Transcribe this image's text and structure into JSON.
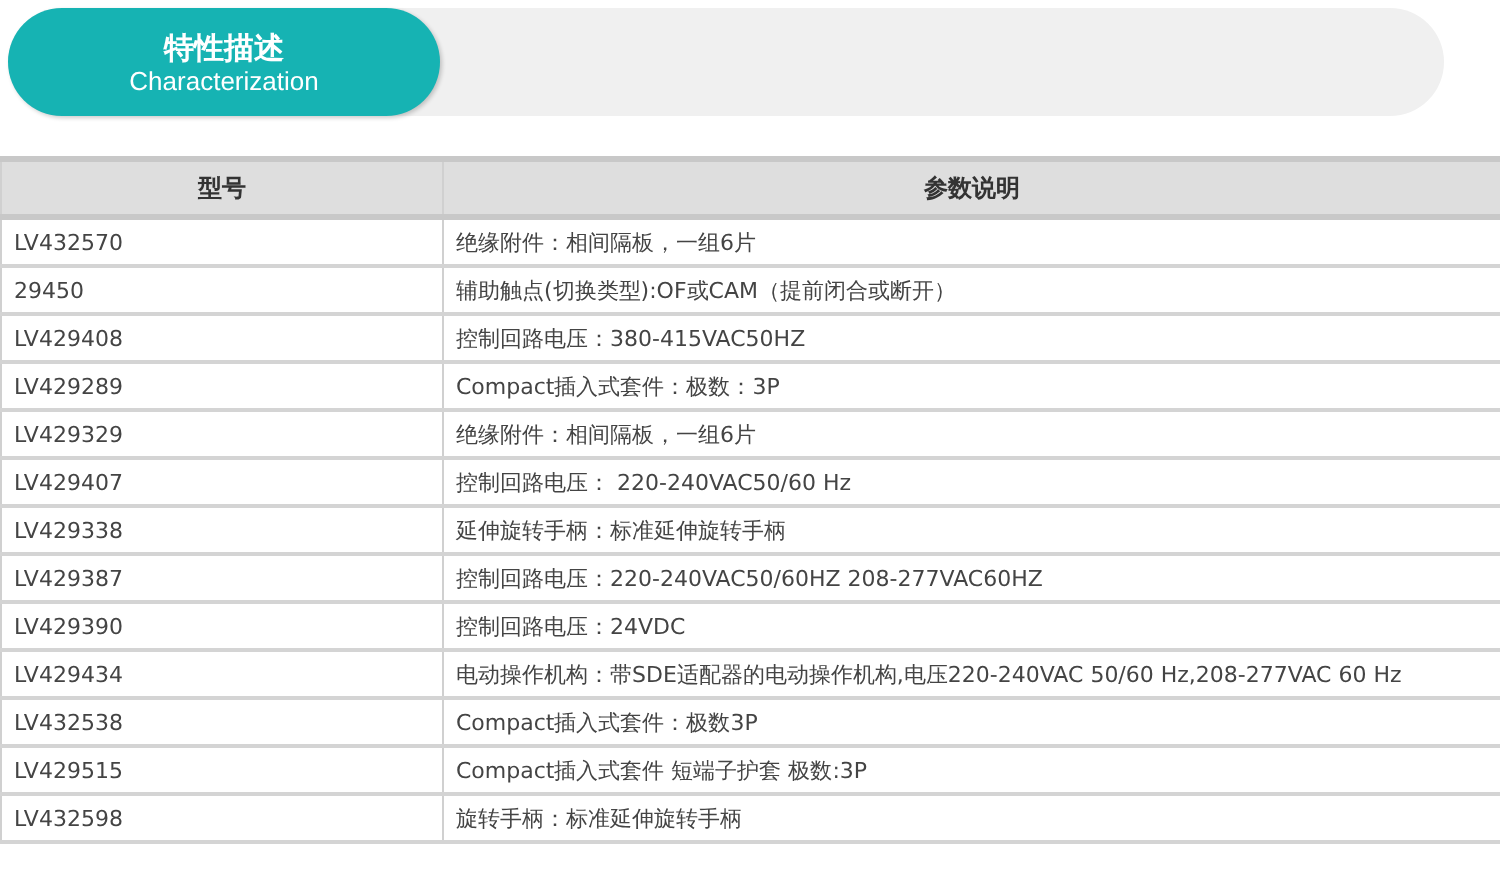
{
  "banner": {
    "title": "特性描述",
    "subtitle": "Characterization"
  },
  "table": {
    "columns": [
      "型号",
      "参数说明"
    ],
    "rows": [
      [
        "LV432570",
        "绝缘附件：相间隔板，一组6片"
      ],
      [
        "29450",
        "辅助触点(切换类型):OF或CAM（提前闭合或断开）"
      ],
      [
        "LV429408",
        "控制回路电压：380-415VAC50HZ"
      ],
      [
        "LV429289",
        "Compact插入式套件：极数：3P"
      ],
      [
        "LV429329",
        "绝缘附件：相间隔板，一组6片"
      ],
      [
        "LV429407",
        "控制回路电压： 220-240VAC50/60 Hz"
      ],
      [
        "LV429338",
        "延伸旋转手柄：标准延伸旋转手柄"
      ],
      [
        "LV429387",
        "控制回路电压：220-240VAC50/60HZ 208-277VAC60HZ"
      ],
      [
        "LV429390",
        "控制回路电压：24VDC"
      ],
      [
        "LV429434",
        "电动操作机构：带SDE适配器的电动操作机构,电压220-240VAC 50/60 Hz,208-277VAC 60 Hz"
      ],
      [
        "LV432538",
        "Compact插入式套件：极数3P"
      ],
      [
        "LV429515",
        "Compact插入式套件 短端子护套 极数:3P"
      ],
      [
        "LV432598",
        "旋转手柄：标准延伸旋转手柄"
      ]
    ]
  }
}
